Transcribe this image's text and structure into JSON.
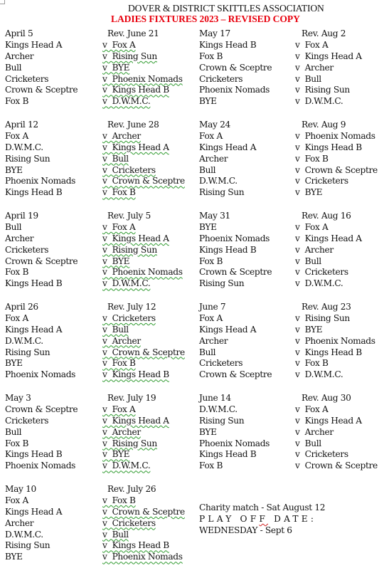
{
  "header": {
    "title": "DOVER & DISTRICT SKITTLES ASSOCIATION",
    "subtitle": "LADIES FIXTURES 2023 – REVISED COPY",
    "subtitle_color": "#e8000d"
  },
  "left_column": [
    {
      "date": "April 5",
      "reverse": "Rev. June 21",
      "fixtures": [
        {
          "home": "Kings Head A",
          "away": "v  Fox A"
        },
        {
          "home": "Archer",
          "away": "v  Rising Sun"
        },
        {
          "home": "Bull",
          "away": "v  BYE"
        },
        {
          "home": "Cricketers",
          "away": "v  Phoenix Nomads"
        },
        {
          "home": "Crown & Sceptre",
          "away": "v  Kings Head B"
        },
        {
          "home": "Fox B",
          "away": "v  D.W.M.C."
        }
      ]
    },
    {
      "date": "April 12",
      "reverse": "Rev. June 28",
      "fixtures": [
        {
          "home": "Fox A",
          "away": "v  Archer"
        },
        {
          "home": "D.W.M.C.",
          "away": "v  Kings Head A"
        },
        {
          "home": "Rising Sun",
          "away": "v  Bull"
        },
        {
          "home": "BYE",
          "away": "v  Cricketers"
        },
        {
          "home": "Phoenix Nomads",
          "away": "v  Crown & Sceptre"
        },
        {
          "home": "Kings Head B",
          "away": "v  Fox B"
        }
      ]
    },
    {
      "date": "April 19",
      "reverse": "Rev. July 5",
      "fixtures": [
        {
          "home": "Bull",
          "away": "v  Fox A"
        },
        {
          "home": "Archer",
          "away": "v  Kings Head A"
        },
        {
          "home": "Cricketers",
          "away": "v  Rising Sun"
        },
        {
          "home": "Crown & Sceptre",
          "away": "v  BYE"
        },
        {
          "home": "Fox B",
          "away": "v  Phoenix Nomads"
        },
        {
          "home": "Kings Head B",
          "away": "v  D.W.M.C."
        }
      ]
    },
    {
      "date": "April 26",
      "reverse": "Rev. July 12",
      "fixtures": [
        {
          "home": "Fox A",
          "away": "v  Cricketers"
        },
        {
          "home": "Kings Head A",
          "away": "v  Bull"
        },
        {
          "home": "D.W.M.C.",
          "away": "v  Archer"
        },
        {
          "home": "Rising Sun",
          "away": "v  Crown & Sceptre"
        },
        {
          "home": "BYE",
          "away": "v  Fox B"
        },
        {
          "home": "Phoenix Nomads",
          "away": "v  Kings Head B"
        }
      ]
    },
    {
      "date": "May 3",
      "reverse": "Rev. July 19",
      "fixtures": [
        {
          "home": "Crown & Sceptre",
          "away": "v  Fox A"
        },
        {
          "home": "Cricketers",
          "away": "v  Kings Head A"
        },
        {
          "home": "Bull",
          "away": "v  Archer"
        },
        {
          "home": "Fox B",
          "away": "v  Rising Sun"
        },
        {
          "home": "Kings Head B",
          "away": "v  BYE"
        },
        {
          "home": "Phoenix Nomads",
          "away": "v  D.W.M.C."
        }
      ]
    },
    {
      "date": "May 10",
      "reverse": "Rev. July 26",
      "fixtures": [
        {
          "home": "Fox A",
          "away": "v  Fox B"
        },
        {
          "home": "Kings Head A",
          "away": "v  Crown & Sceptre"
        },
        {
          "home": "Archer",
          "away": "v  Cricketers"
        },
        {
          "home": "D.W.M.C.",
          "away": "v  Bull"
        },
        {
          "home": "Rising Sun",
          "away": "v  Kings Head B"
        },
        {
          "home": "BYE",
          "away": "v  Phoenix Nomads"
        }
      ]
    }
  ],
  "right_column": [
    {
      "date": "May 17",
      "reverse": "Rev. Aug 2",
      "fixtures": [
        {
          "home": "Kings Head B",
          "away": "v  Fox A"
        },
        {
          "home": "Fox B",
          "away": "v  Kings Head A"
        },
        {
          "home": "Crown & Sceptre",
          "away": "v  Archer"
        },
        {
          "home": "Cricketers",
          "away": "v  Bull"
        },
        {
          "home": "Phoenix Nomads",
          "away": "v  Rising Sun"
        },
        {
          "home": "BYE",
          "away": "v  D.W.M.C."
        }
      ]
    },
    {
      "date": "May 24",
      "reverse": "Rev. Aug 9",
      "fixtures": [
        {
          "home": "Fox A",
          "away": "v  Phoenix Nomads"
        },
        {
          "home": "Kings Head A",
          "away": "v  Kings Head B"
        },
        {
          "home": "Archer",
          "away": "v  Fox B"
        },
        {
          "home": "Bull",
          "away": "v  Crown & Sceptre"
        },
        {
          "home": "D.W.M.C.",
          "away": "v  Cricketers"
        },
        {
          "home": "Rising Sun",
          "away": "v  BYE"
        }
      ]
    },
    {
      "date": "May 31",
      "reverse": "Rev. Aug 16",
      "fixtures": [
        {
          "home": "BYE",
          "away": "v  Fox A"
        },
        {
          "home": "Phoenix Nomads",
          "away": "v  Kings Head A"
        },
        {
          "home": "Kings Head B",
          "away": "v  Archer"
        },
        {
          "home": "Fox B",
          "away": "v  Bull"
        },
        {
          "home": "Crown & Sceptre",
          "away": "v  Cricketers"
        },
        {
          "home": "Rising Sun",
          "away": "v  D.W.M.C."
        }
      ]
    },
    {
      "date": "June 7",
      "reverse": "Rev. Aug 23",
      "fixtures": [
        {
          "home": "Fox A",
          "away": "v  Rising Sun"
        },
        {
          "home": "Kings Head A",
          "away": "v  BYE"
        },
        {
          "home": "Archer",
          "away": "v  Phoenix Nomads"
        },
        {
          "home": "Bull",
          "away": "v  Kings Head B"
        },
        {
          "home": "Cricketers",
          "away": "v  Fox B"
        },
        {
          "home": "Crown & Sceptre",
          "away": "v  D.W.M.C."
        }
      ]
    },
    {
      "date": "June 14",
      "reverse": "Rev. Aug 30",
      "fixtures": [
        {
          "home": "D.W.M.C.",
          "away": "v  Fox A"
        },
        {
          "home": "Rising Sun",
          "away": "v  Kings Head A"
        },
        {
          "home": "BYE",
          "away": "v  Archer"
        },
        {
          "home": "Phoenix Nomads",
          "away": "v  Bull"
        },
        {
          "home": "Kings Head B",
          "away": "v  Cricketers"
        },
        {
          "home": "Fox B",
          "away": "v  Crown & Sceptre"
        }
      ]
    }
  ],
  "notes": {
    "charity": "Charity match - Sat August 12",
    "playoff_label": "PLAY OFF DATE:",
    "playoff_date": "WEDNESDAY - Sept 6"
  }
}
